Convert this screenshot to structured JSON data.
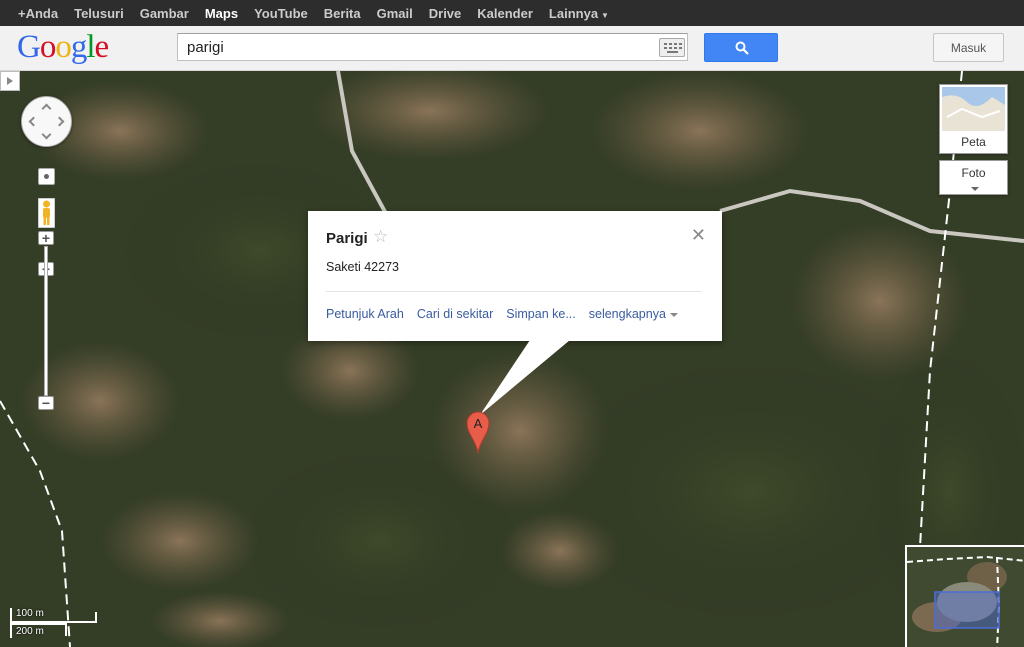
{
  "topbar": {
    "items": [
      {
        "label": "+Anda",
        "active": false
      },
      {
        "label": "Telusuri",
        "active": false
      },
      {
        "label": "Gambar",
        "active": false
      },
      {
        "label": "Maps",
        "active": true
      },
      {
        "label": "YouTube",
        "active": false
      },
      {
        "label": "Berita",
        "active": false
      },
      {
        "label": "Gmail",
        "active": false
      },
      {
        "label": "Drive",
        "active": false
      },
      {
        "label": "Kalender",
        "active": false
      },
      {
        "label": "Lainnya",
        "active": false
      }
    ]
  },
  "header": {
    "logo": "Google",
    "search": {
      "value": "parigi",
      "icon": "keyboard-icon"
    },
    "search_button_icon": "magnifier-icon",
    "signin_label": "Masuk"
  },
  "map": {
    "view": "satellite",
    "maptypes": {
      "map_label": "Peta",
      "photo_label": "Foto"
    },
    "scale": {
      "small": "100 m",
      "large": "200 m"
    }
  },
  "infowindow": {
    "title": "Parigi",
    "address": "Saketi 42273",
    "links": [
      "Petunjuk Arah",
      "Cari di sekitar",
      "Simpan ke...",
      "selengkapnya"
    ]
  },
  "marker": {
    "label": "A",
    "color": "#e85c4a"
  }
}
